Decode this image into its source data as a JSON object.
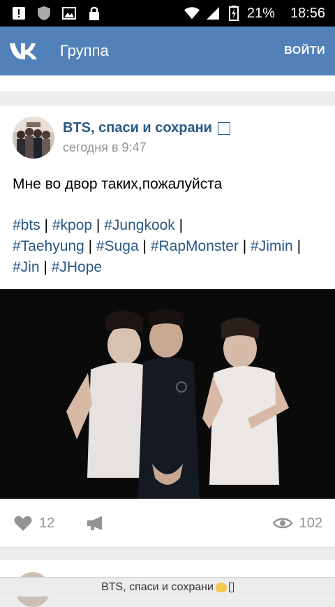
{
  "statusbar": {
    "battery": "21%",
    "time": "18:56",
    "icons": [
      "alert-icon",
      "shield-icon",
      "image-icon",
      "lock-icon",
      "wifi-icon",
      "signal-icon",
      "battery-icon"
    ]
  },
  "topbar": {
    "title": "Группа",
    "login_label": "ВОЙТИ",
    "accent": "#5181b8"
  },
  "post": {
    "group_name": "BTS, спаси и сохрани",
    "time": "сегодня в 9:47",
    "text": "Мне во двор таких,пожалуйста",
    "tags": [
      "#bts",
      "#kpop",
      "#Jungkook",
      "#Taehyung",
      "#Suga",
      "#RapMonster",
      "#Jimin",
      "#Jin",
      "#JHope"
    ],
    "separator": "|",
    "likes": "12",
    "views": "102"
  },
  "footer": {
    "title": "BTS, спаси и сохрани"
  }
}
